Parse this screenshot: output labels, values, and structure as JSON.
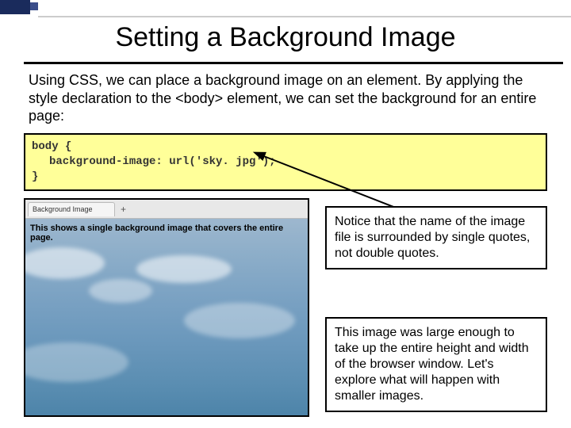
{
  "slide": {
    "title": "Setting a Background Image",
    "intro": "Using CSS, we can place a background image on an element.  By applying the style declaration to the <body> element, we can set the background for an entire page:"
  },
  "code": {
    "line1": "body {",
    "line2": "background-image: url('sky. jpg');",
    "line3": "}"
  },
  "preview": {
    "tab_label": "Background Image",
    "plus": "+",
    "caption": "This shows a single background image that covers the entire page."
  },
  "callouts": {
    "note1": "Notice that the name of the image file is surrounded by single quotes, not double quotes.",
    "note2": "This image was large enough to take up the entire height and width of the browser window. Let's explore what will happen with smaller images."
  }
}
